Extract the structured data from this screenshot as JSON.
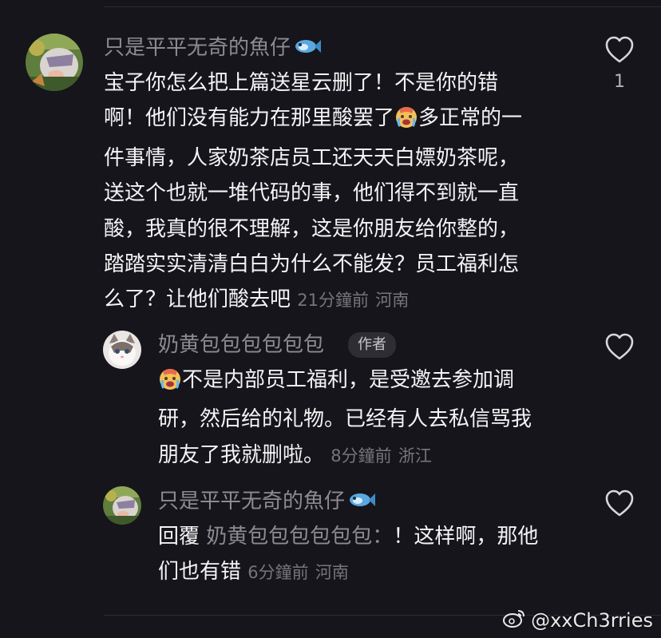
{
  "comments": [
    {
      "username": "只是平平无奇的魚仔",
      "username_emoji": "fish-icon",
      "lines": [
        "宝子你怎么把上篇送星云删了！不是你的错",
        "啊！他们没有能力在那里酸罢了",
        "多正常的一",
        "件事情，人家奶茶店员工还天天白嫖奶茶呢，",
        "送这个也就一堆代码的事，他们得不到就一直",
        "酸，我真的很不理解，这是你朋友给你整的，",
        "踏踏实实清清白白为什么不能发？员工福利怎",
        "么了？让他们酸去吧"
      ],
      "time": "21分鐘前",
      "location": "河南",
      "like_count": "1"
    },
    {
      "username": "奶黄包包包包包包",
      "badge": "作者",
      "lines": [
        "不是内部员工福利，是受邀去参加调",
        "研，然后给的礼物。已经有人去私信骂我",
        "朋友了我就删啦。"
      ],
      "time": "8分鐘前",
      "location": "浙江"
    },
    {
      "username": "只是平平无奇的魚仔",
      "username_emoji": "fish-icon",
      "reply_prefix": "回覆",
      "reply_to": "奶黄包包包包包包",
      "reply_colon": "：",
      "lines": [
        "！这样啊，那他",
        "们也有错"
      ],
      "time": "6分鐘前",
      "location": "河南"
    }
  ],
  "watermark": "@xxCh3rries",
  "colors": {
    "background": "#16151b",
    "text": "#f4f4f6",
    "username": "#8c8b91",
    "meta": "#76757b"
  }
}
